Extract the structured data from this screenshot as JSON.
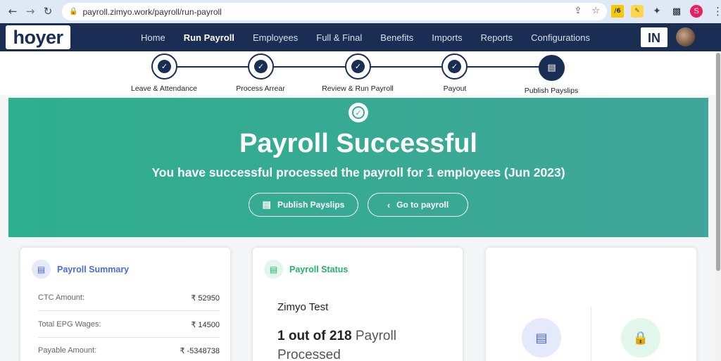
{
  "browser": {
    "url": "payroll.zimyo.work/payroll/run-payroll",
    "profile_initial": "S"
  },
  "app": {
    "logo_text": "hoyer",
    "menu": [
      {
        "label": "Home"
      },
      {
        "label": "Run Payroll",
        "active": true
      },
      {
        "label": "Employees"
      },
      {
        "label": "Full & Final"
      },
      {
        "label": "Benefits"
      },
      {
        "label": "Imports"
      },
      {
        "label": "Reports"
      },
      {
        "label": "Configurations"
      }
    ],
    "country_flag_text": "IN"
  },
  "stepper": {
    "steps": [
      {
        "label": "Leave & Attendance",
        "state": "done"
      },
      {
        "label": "Process Arrear",
        "state": "done"
      },
      {
        "label": "Review & Run Payroll",
        "state": "done"
      },
      {
        "label": "Payout",
        "state": "done"
      },
      {
        "label": "Publish Payslips",
        "state": "current"
      }
    ]
  },
  "banner": {
    "title": "Payroll Successful",
    "subtitle": "You have successful processed the payroll for 1 employees (Jun 2023)",
    "publish_button": "Publish Payslips",
    "go_button": "Go to payroll",
    "color": "#2eaf8e"
  },
  "summary": {
    "title": "Payroll Summary",
    "rows": [
      {
        "label": "CTC Amount:",
        "value": "₹ 52950"
      },
      {
        "label": "Total EPG Wages:",
        "value": "₹ 14500"
      },
      {
        "label": "Payable Amount:",
        "value": "₹ -5348738"
      }
    ]
  },
  "status": {
    "title": "Payroll Status",
    "org_name": "Zimyo Test",
    "count_bold": "1 out of 218",
    "count_rest": " Payroll Processed"
  },
  "colors": {
    "navy": "#1a2d53",
    "accent_blue": "#4a6be0",
    "accent_green": "#22b36b"
  }
}
